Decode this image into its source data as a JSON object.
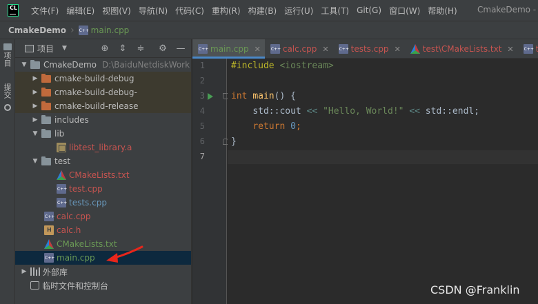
{
  "menubar": {
    "logo": "CL",
    "items": [
      "文件(F)",
      "编辑(E)",
      "视图(V)",
      "导航(N)",
      "代码(C)",
      "重构(R)",
      "构建(B)",
      "运行(U)",
      "工具(T)",
      "Git(G)",
      "窗口(W)",
      "帮助(H)"
    ],
    "window_title": "CmakeDemo -"
  },
  "breadcrumb": {
    "project": "CmakeDemo",
    "file": "main.cpp"
  },
  "left_strip": {
    "project_tab": "项目",
    "commit_tab": "提交"
  },
  "project_panel": {
    "title": "项目",
    "tree": [
      {
        "label": "CmakeDemo",
        "hint": "D:\\BaiduNetdiskWork",
        "kind": "folder",
        "expanded": true,
        "color": "white"
      },
      {
        "label": "cmake-build-debug",
        "kind": "folder-orange",
        "expanded": false,
        "color": "white"
      },
      {
        "label": "cmake-build-debug-",
        "kind": "folder-orange",
        "expanded": false,
        "color": "white"
      },
      {
        "label": "cmake-build-release",
        "kind": "folder-orange",
        "expanded": false,
        "color": "white"
      },
      {
        "label": "includes",
        "kind": "folder",
        "expanded": false,
        "color": "white"
      },
      {
        "label": "lib",
        "kind": "folder",
        "expanded": true,
        "color": "white"
      },
      {
        "label": "libtest_library.a",
        "kind": "lib",
        "color": "red"
      },
      {
        "label": "test",
        "kind": "folder",
        "expanded": true,
        "color": "white"
      },
      {
        "label": "CMakeLists.txt",
        "kind": "cmake",
        "color": "red"
      },
      {
        "label": "test.cpp",
        "kind": "cpp",
        "color": "red"
      },
      {
        "label": "tests.cpp",
        "kind": "cpp",
        "color": "blue"
      },
      {
        "label": "calc.cpp",
        "kind": "cpp",
        "color": "red"
      },
      {
        "label": "calc.h",
        "kind": "h",
        "color": "red"
      },
      {
        "label": "CMakeLists.txt",
        "kind": "cmake",
        "color": "green"
      },
      {
        "label": "main.cpp",
        "kind": "cpp",
        "color": "green"
      },
      {
        "label": "外部库",
        "kind": "extlib",
        "color": "white"
      },
      {
        "label": "临时文件和控制台",
        "kind": "scratch",
        "color": "white"
      }
    ]
  },
  "tabs": [
    {
      "label": "main.cpp",
      "kind": "cpp",
      "active": true
    },
    {
      "label": "calc.cpp",
      "kind": "cpp"
    },
    {
      "label": "tests.cpp",
      "kind": "cpp"
    },
    {
      "label": "test\\CMakeLists.txt",
      "kind": "cmake"
    },
    {
      "label": "te",
      "kind": "cpp"
    }
  ],
  "editor": {
    "line_numbers": [
      "1",
      "2",
      "3",
      "4",
      "5",
      "6",
      "7"
    ],
    "current_line": "7",
    "code": {
      "l1_directive": "#include",
      "l1_header": "<iostream>",
      "l3_kw": "int",
      "l3_fn": "main",
      "l3_rest": "() {",
      "l4_indent": "    ",
      "l4_a": "std::cout",
      "l4_op1": "<<",
      "l4_str": "\"Hello, World!\"",
      "l4_op2": "<<",
      "l4_b": "std::endl;",
      "l5_kw": "return",
      "l5_num": "0",
      "l5_semi": ";",
      "l6": "}"
    }
  },
  "watermark": "CSDN @Franklin",
  "colors": {
    "accent": "#4a88c7",
    "annotation_arrow": "#e8261b"
  }
}
